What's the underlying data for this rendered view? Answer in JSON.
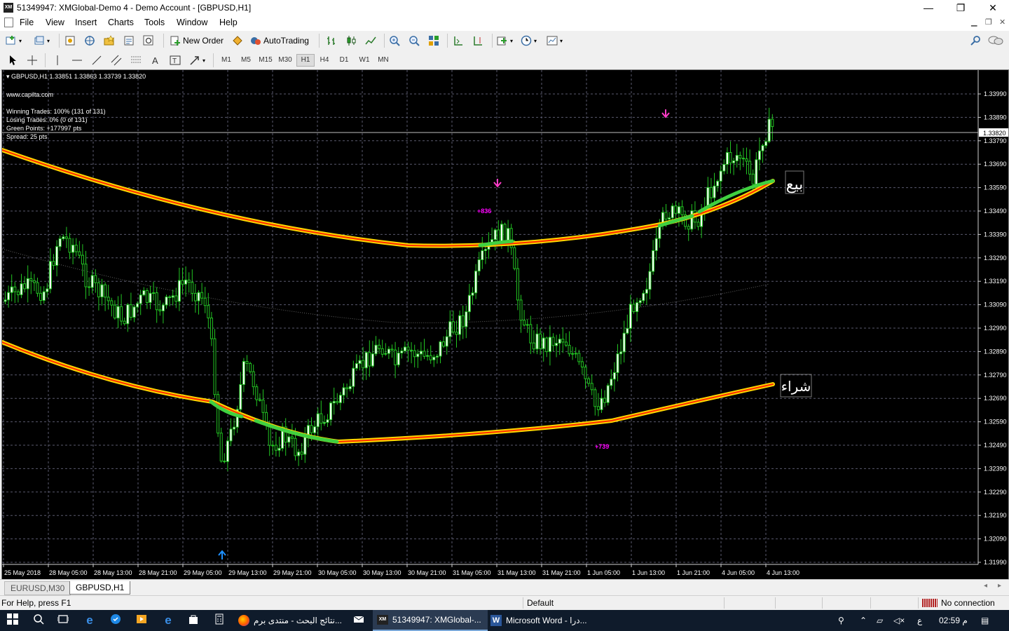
{
  "window": {
    "title": "51349947: XMGlobal-Demo 4 - Demo Account - [GBPUSD,H1]",
    "app_icon_text": "XM",
    "minimize": "—",
    "restore": "❐",
    "close": "✕"
  },
  "menu": [
    "File",
    "View",
    "Insert",
    "Charts",
    "Tools",
    "Window",
    "Help"
  ],
  "toolbar": {
    "new_order_label": "New Order",
    "autotrading_label": "AutoTrading"
  },
  "timeframes": [
    "M1",
    "M5",
    "M15",
    "M30",
    "H1",
    "H4",
    "D1",
    "W1",
    "MN"
  ],
  "active_timeframe": "H1",
  "chart": {
    "header": "GBPUSD,H1  1.33851 1.33863 1.33739 1.33820",
    "website": "www.capilta.com",
    "stats": [
      "Winning Trades: 100% (131 of 131)",
      "Losing Trades: 0% (0 of 131)",
      "Green Points: +177997 pts",
      "Spread: 25 pts"
    ],
    "current_price": "1.33820",
    "sell_label": "بيع",
    "buy_label": "شراء",
    "profit_labels": [
      "+836",
      "+739"
    ],
    "price_ticks": [
      "1.33990",
      "1.33890",
      "1.33790",
      "1.33690",
      "1.33590",
      "1.33490",
      "1.33390",
      "1.33290",
      "1.33190",
      "1.33090",
      "1.32990",
      "1.32890",
      "1.32790",
      "1.32690",
      "1.32590",
      "1.32490",
      "1.32390",
      "1.32290",
      "1.32190",
      "1.32090",
      "1.31990"
    ],
    "time_ticks": [
      "25 May 2018",
      "28 May 05:00",
      "28 May 13:00",
      "28 May 21:00",
      "29 May 05:00",
      "29 May 13:00",
      "29 May 21:00",
      "30 May 05:00",
      "30 May 13:00",
      "30 May 21:00",
      "31 May 05:00",
      "31 May 13:00",
      "31 May 21:00",
      "1 Jun 05:00",
      "1 Jun 13:00",
      "1 Jun 21:00",
      "4 Jun 05:00",
      "4 Jun 13:00"
    ],
    "colors": {
      "background": "#000000",
      "grid": "#5a5a6e",
      "candle": "#22c522",
      "band_outer": "#ffd700",
      "band_inner": "#ff2a00",
      "band_highlight": "#40d040",
      "down_arrow": "#ff3cc8",
      "up_arrow": "#1e90ff",
      "profit_text": "#ff00ff"
    }
  },
  "tabs": [
    "EURUSD,M30",
    "GBPUSD,H1"
  ],
  "active_tab": "GBPUSD,H1",
  "status": {
    "help": "For Help, press F1",
    "profile": "Default",
    "connection": "No connection"
  },
  "taskbar": {
    "items": [
      {
        "label": "نتائج البحث - منتدى برم...",
        "icon": "firefox-icon"
      },
      {
        "label": "51349947: XMGlobal-...",
        "icon": "xm-icon"
      },
      {
        "label": "Microsoft Word - درا...",
        "icon": "word-icon"
      }
    ],
    "lang": "ع",
    "time": "02:59 م"
  }
}
